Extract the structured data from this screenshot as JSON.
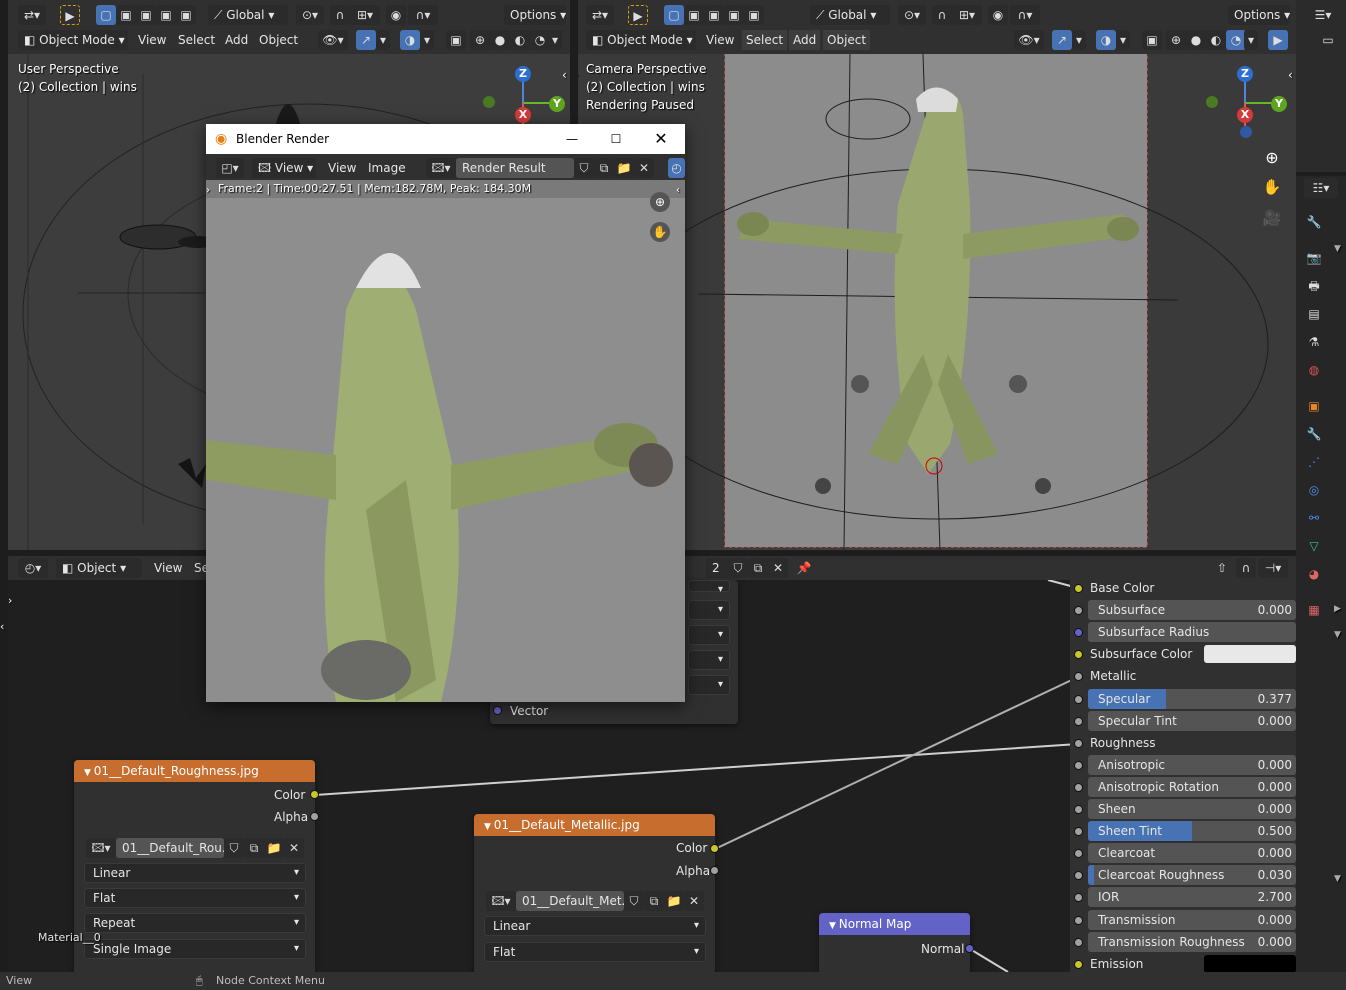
{
  "top_header": {
    "options_label": "Options",
    "transform_space": "Global",
    "options_label_right": "Options",
    "transform_space_right": "Global"
  },
  "viewport_left": {
    "mode": "Object Mode",
    "menu": [
      "View",
      "Select",
      "Add",
      "Object"
    ],
    "overlay_line1": "User Perspective",
    "overlay_line2": "(2) Collection | wins"
  },
  "viewport_right": {
    "mode": "Object Mode",
    "menu": [
      "View",
      "Select",
      "Add",
      "Object"
    ],
    "overlay_line1": "Camera Perspective",
    "overlay_line2": "(2) Collection | wins",
    "overlay_line3": "Rendering Paused"
  },
  "gizmo": {
    "x": "X",
    "y": "Y",
    "z": "Z"
  },
  "render_window": {
    "title": "Blender Render",
    "menu": [
      "View",
      "View",
      "Image"
    ],
    "image_name": "Render Result",
    "stats": "Frame:2 | Time:00:27.51 | Mem:182.78M, Peak: 184.30M"
  },
  "node_editor": {
    "header_type": "Object",
    "header_menu": [
      "View",
      "Se"
    ],
    "users_count": "2",
    "vector_label": "Vector",
    "material_label": "Material__0"
  },
  "node_roughness": {
    "title": "01__Default_Roughness.jpg",
    "out_color": "Color",
    "out_alpha": "Alpha",
    "image_name": "01__Default_Rou...",
    "interpolation": "Linear",
    "projection": "Flat",
    "extension": "Repeat",
    "source": "Single Image"
  },
  "node_metallic": {
    "title": "01__Default_Metallic.jpg",
    "out_color": "Color",
    "out_alpha": "Alpha",
    "image_name": "01__Default_Met...",
    "interpolation": "Linear",
    "projection": "Flat"
  },
  "node_normal": {
    "title": "Normal Map",
    "out_normal": "Normal"
  },
  "bsdf": {
    "rows": [
      {
        "label": "Base Color",
        "value": "",
        "type": "plain",
        "socket": "#c7c729"
      },
      {
        "label": "Subsurface",
        "value": "0.000",
        "type": "field",
        "socket": "#a1a1a1"
      },
      {
        "label": "Subsurface Radius",
        "value": "",
        "type": "field",
        "socket": "#6363c7"
      },
      {
        "label": "Subsurface Color",
        "value": "",
        "type": "color",
        "socket": "#c7c729"
      },
      {
        "label": "Metallic",
        "value": "",
        "type": "plain",
        "socket": "#a1a1a1"
      },
      {
        "label": "Specular",
        "value": "0.377",
        "type": "slider",
        "socket": "#a1a1a1",
        "fill": 0.377
      },
      {
        "label": "Specular Tint",
        "value": "0.000",
        "type": "field",
        "socket": "#a1a1a1"
      },
      {
        "label": "Roughness",
        "value": "",
        "type": "plain",
        "socket": "#a1a1a1"
      },
      {
        "label": "Anisotropic",
        "value": "0.000",
        "type": "field",
        "socket": "#a1a1a1"
      },
      {
        "label": "Anisotropic Rotation",
        "value": "0.000",
        "type": "field",
        "socket": "#a1a1a1"
      },
      {
        "label": "Sheen",
        "value": "0.000",
        "type": "field",
        "socket": "#a1a1a1"
      },
      {
        "label": "Sheen Tint",
        "value": "0.500",
        "type": "slider",
        "socket": "#a1a1a1",
        "fill": 0.5
      },
      {
        "label": "Clearcoat",
        "value": "0.000",
        "type": "field",
        "socket": "#a1a1a1"
      },
      {
        "label": "Clearcoat Roughness",
        "value": "0.030",
        "type": "slider",
        "socket": "#a1a1a1",
        "fill": 0.03
      },
      {
        "label": "IOR",
        "value": "2.700",
        "type": "field",
        "socket": "#a1a1a1"
      },
      {
        "label": "Transmission",
        "value": "0.000",
        "type": "field",
        "socket": "#a1a1a1"
      },
      {
        "label": "Transmission Roughness",
        "value": "0.000",
        "type": "field",
        "socket": "#a1a1a1"
      },
      {
        "label": "Emission",
        "value": "",
        "type": "black",
        "socket": "#c7c729"
      }
    ]
  },
  "status_bar": {
    "left": "View",
    "middle": "Node Context Menu"
  },
  "colors": {
    "accent": "#4772b3",
    "image_node_header": "#c76d2e",
    "vector_node_header": "#6363c7"
  }
}
